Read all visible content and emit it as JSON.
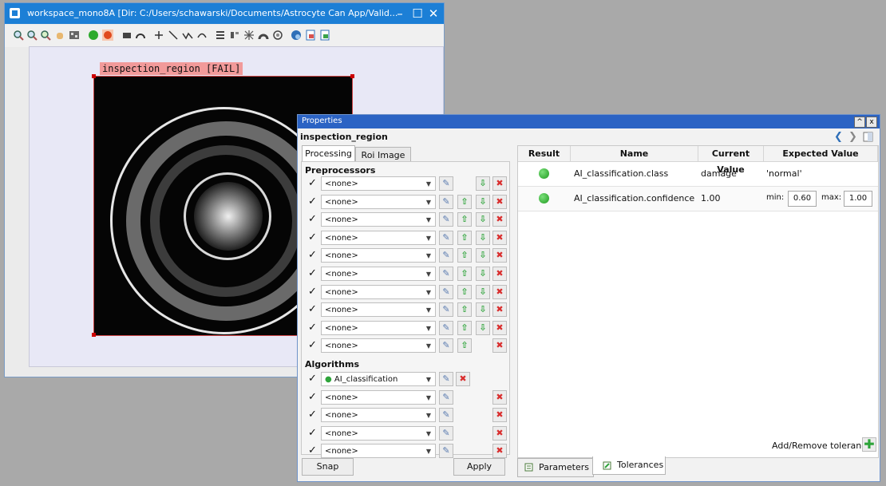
{
  "workspace": {
    "title": "workspace_mono8A [Dir: C:/Users/schawarski/Documents/Astrocyte Can App/Valid...",
    "roi_label": "inspection_region [FAIL]",
    "window_buttons": {
      "minimize": "–",
      "maximize": "☐",
      "close": "✕"
    }
  },
  "properties": {
    "title": "Properties",
    "roi_name": "inspection_region",
    "window_buttons": {
      "collapse": "^",
      "close": "x"
    },
    "tabs": [
      {
        "label": "Processing"
      },
      {
        "label": "Roi Image"
      }
    ],
    "sections": {
      "preprocessors": "Preprocessors",
      "algorithms": "Algorithms"
    },
    "none_label": "<none>",
    "algorithm_name": "AI_classification",
    "snap_label": "Snap",
    "apply_label": "Apply",
    "table": {
      "headers": [
        "Result",
        "Name",
        "Current Value",
        "Expected Value"
      ],
      "rows": [
        {
          "result": "pass",
          "name": "AI_classification.class",
          "current": "damage",
          "expected": "'normal'"
        },
        {
          "result": "pass",
          "name": "AI_classification.confidence",
          "current": "1.00",
          "min_label": "min:",
          "min": "0.60",
          "max_label": "max:",
          "max": "1.00"
        }
      ]
    },
    "add_tolerance_label": "Add/Remove tolerance",
    "bottom_tabs": [
      {
        "label": "Parameters"
      },
      {
        "label": "Tolerances"
      }
    ]
  },
  "colors": {
    "titlebar": "#1c7fd6",
    "panel_titlebar": "#2b63c4",
    "fail_label": "#f29a9a",
    "pass_dot": "#2ea43a"
  }
}
